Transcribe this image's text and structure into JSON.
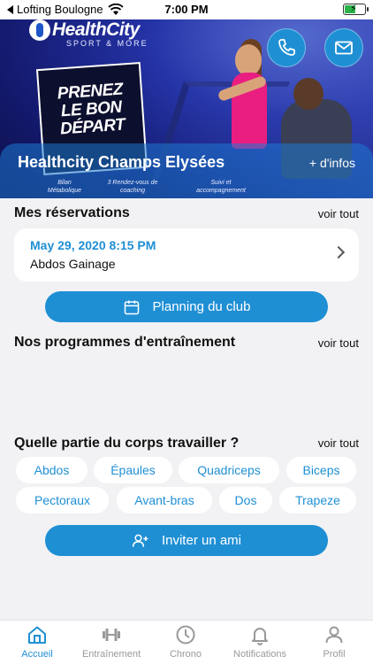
{
  "status_bar": {
    "back_label": "Lofting Boulogne",
    "time": "7:00 PM"
  },
  "hero": {
    "logo_name": "HealthCity",
    "logo_tag": "SPORT & MORE",
    "slogan": [
      "PRENEZ",
      "LE BON",
      "DÉPART"
    ],
    "captions": [
      "Bilan Métabolique",
      "3 Rendez-vous de coaching",
      "Suivi et accompagnement"
    ],
    "club_name": "Healthcity Champs Elysées",
    "more_info": "+ d'infos"
  },
  "reservations": {
    "title": "Mes réservations",
    "see_all": "voir tout",
    "item": {
      "date": "May 29, 2020 8:15 PM",
      "name": "Abdos Gainage"
    }
  },
  "planning_button": "Planning du club",
  "programs": {
    "title": "Nos programmes d'entraînement",
    "see_all": "voir tout"
  },
  "body_parts": {
    "title": "Quelle partie du corps travailler ?",
    "see_all": "voir tout",
    "chips": [
      "Abdos",
      "Épaules",
      "Quadriceps",
      "Biceps",
      "Pectoraux",
      "Avant-bras",
      "Dos",
      "Trapeze"
    ]
  },
  "invite_button": "Inviter un ami",
  "tabbar": {
    "tabs": [
      {
        "label": "Accueil",
        "icon": "home-icon",
        "active": true
      },
      {
        "label": "Entraînement",
        "icon": "dumbbell-icon",
        "active": false
      },
      {
        "label": "Chrono",
        "icon": "clock-icon",
        "active": false
      },
      {
        "label": "Notifications",
        "icon": "bell-icon",
        "active": false
      },
      {
        "label": "Profil",
        "icon": "person-icon",
        "active": false
      }
    ]
  },
  "colors": {
    "accent": "#1f8fd4",
    "background": "#f2f2f4",
    "active_tab": "#1f8fd4",
    "inactive_tab": "#999999"
  }
}
